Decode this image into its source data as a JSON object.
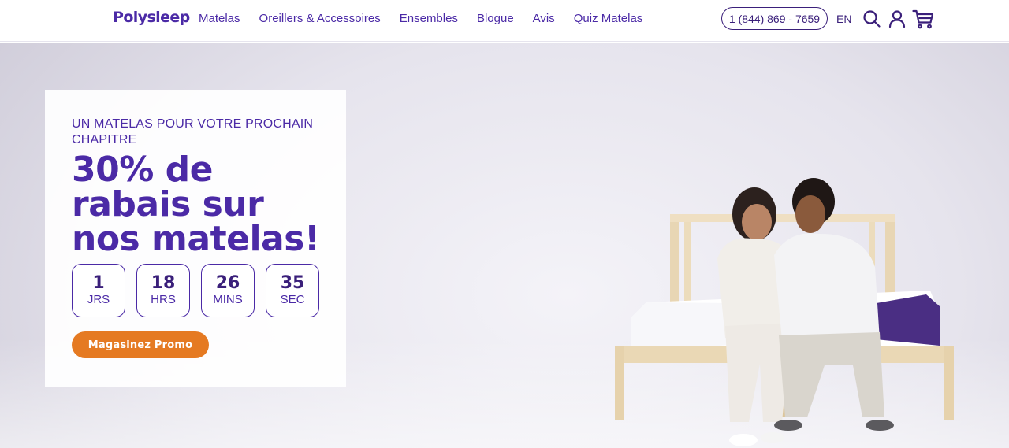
{
  "header": {
    "logo": "Polysleep",
    "nav": [
      "Matelas",
      "Oreillers & Accessoires",
      "Ensembles",
      "Blogue",
      "Avis",
      "Quiz Matelas"
    ],
    "phone": "1 (844) 869 - 7659",
    "language": "EN",
    "icons": [
      "search-icon",
      "account-icon",
      "cart-icon"
    ]
  },
  "hero": {
    "eyebrow": "UN MATELAS POUR VOTRE PROCHAIN CHAPITRE",
    "headline": "30% de rabais sur nos matelas!",
    "countdown": [
      {
        "value": "1",
        "unit": "JRS"
      },
      {
        "value": "18",
        "unit": "HRS"
      },
      {
        "value": "26",
        "unit": "MINS"
      },
      {
        "value": "35",
        "unit": "SEC"
      }
    ],
    "cta_label": "Magasinez Promo"
  },
  "colors": {
    "brand_purple": "#4b2aa6",
    "dark_purple": "#3a1f7a",
    "cta_orange": "#e57a22"
  }
}
